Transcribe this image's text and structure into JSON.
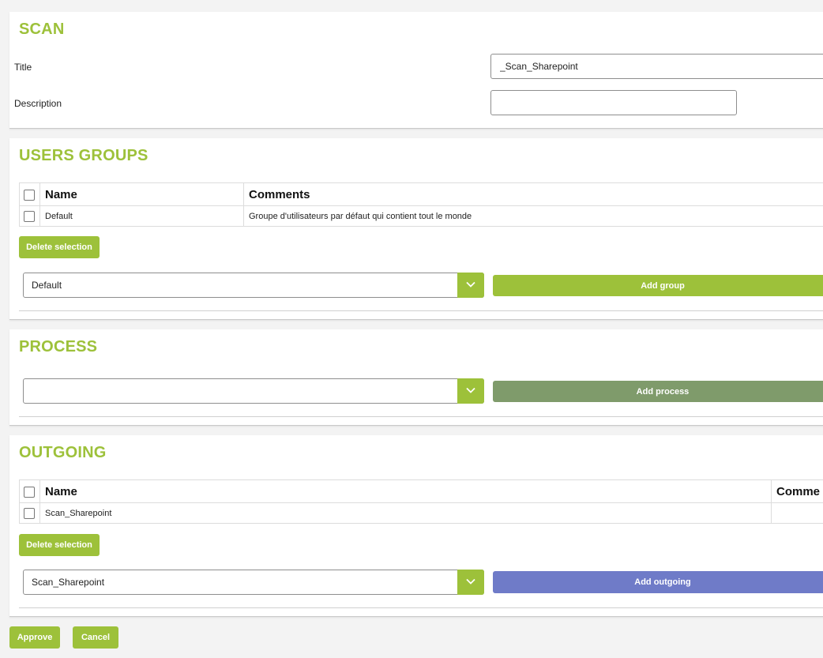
{
  "scan": {
    "heading": "SCAN",
    "title_label": "Title",
    "title_value": "_Scan_Sharepoint",
    "description_label": "Description",
    "description_value": ""
  },
  "users_groups": {
    "heading": "USERS GROUPS",
    "columns": [
      "Name",
      "Comments"
    ],
    "rows": [
      {
        "name": "Default",
        "comment": "Groupe d'utilisateurs par défaut qui contient tout le monde"
      }
    ],
    "delete_label": "Delete selection",
    "select_value": "Default",
    "add_label": "Add group"
  },
  "process": {
    "heading": "PROCESS",
    "select_value": "",
    "add_label": "Add process"
  },
  "outgoing": {
    "heading": "OUTGOING",
    "columns": [
      "Name",
      "Comme"
    ],
    "rows": [
      {
        "name": "Scan_Sharepoint",
        "comment": ""
      }
    ],
    "delete_label": "Delete selection",
    "select_value": "Scan_Sharepoint",
    "add_label": "Add outgoing"
  },
  "footer": {
    "approve_label": "Approve",
    "cancel_label": "Cancel"
  },
  "colors": {
    "accent": "#9dc13a",
    "process_button": "#7f9b6b",
    "outgoing_button": "#6f7bc8"
  }
}
